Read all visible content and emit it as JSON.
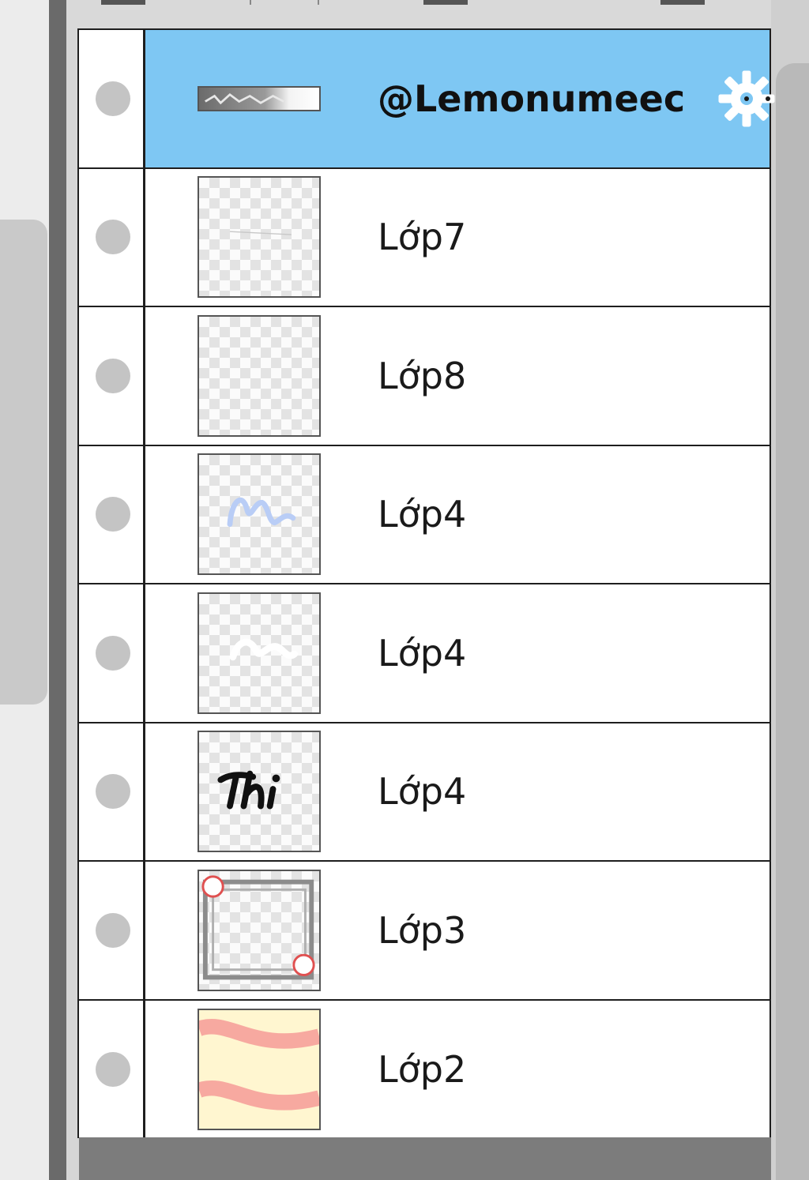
{
  "layers_panel": {
    "layers": [
      {
        "name": "@Lemonumeec",
        "selected": true,
        "thumbnail": "text-layer",
        "type": "text"
      },
      {
        "name": "Lớp7",
        "selected": false,
        "thumbnail": "faint-line"
      },
      {
        "name": "Lớp8",
        "selected": false,
        "thumbnail": "empty"
      },
      {
        "name": "Lớp4",
        "selected": false,
        "thumbnail": "blue-script-stroke"
      },
      {
        "name": "Lớp4",
        "selected": false,
        "thumbnail": "white-stroke"
      },
      {
        "name": "Lớp4",
        "selected": false,
        "thumbnail": "black-script-text"
      },
      {
        "name": "Lớp3",
        "selected": false,
        "thumbnail": "frame-border"
      },
      {
        "name": "Lớp2",
        "selected": false,
        "thumbnail": "pink-waves"
      }
    ],
    "selected_icon": "gear-icon",
    "visibility_icon": "visibility-dot-icon"
  },
  "colors": {
    "selection": "#7ec7f3",
    "row_border": "#1e1e1e",
    "visibility_dot": "#c4c4c4",
    "wave_stripe": "#f7a9a0",
    "wave_background": "#fff6d0",
    "blue_stroke": "#b9cdf6",
    "frame_accent": "#e05050"
  }
}
